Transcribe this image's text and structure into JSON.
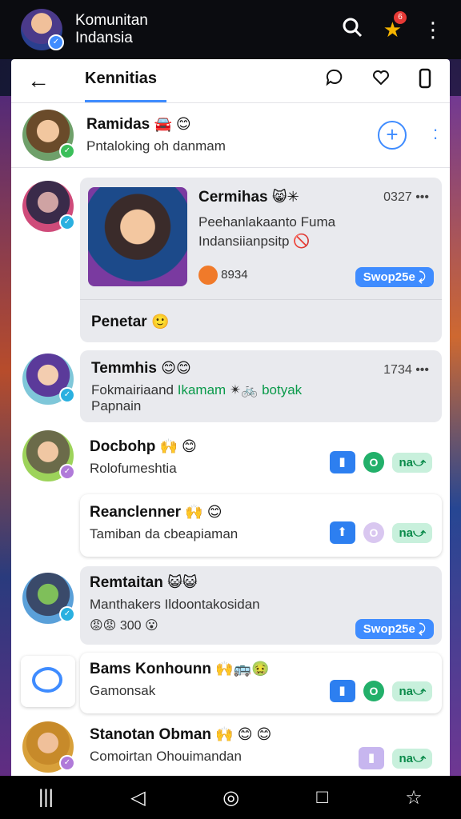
{
  "app": {
    "title_line1": "Komunitan",
    "title_line2": "Indansia",
    "notif_count": "6"
  },
  "tabbar": {
    "tab_label": "Kennitias"
  },
  "header": {
    "name": "Ramidas",
    "subtitle": "Pntaloking oh danmam"
  },
  "post": {
    "title": "Cermihas",
    "time": "0327",
    "line1": "Peehanlakaanto Fuma",
    "line2": "Indansiianpsitp",
    "stat": "8934",
    "pill": "Swop25e",
    "footer": "Penetar"
  },
  "items": [
    {
      "name": "Temmhis",
      "time": "1734",
      "line1": "Fokmairiaand",
      "line1_green": "Ikamam",
      "line1_tail": "botyak",
      "line2": "Papnain"
    },
    {
      "name": "Docbohp",
      "sub": "Rolofumeshtia",
      "btn_pill": "na"
    },
    {
      "name": "Reanclenner",
      "sub": "Tamiban da cbeapiaman",
      "btn_pill": "na"
    },
    {
      "name": "Remtaitan",
      "sub": "Manthakers Ildoontakosidan",
      "count": "300",
      "pill": "Swop25e"
    },
    {
      "name": "Bams Konhounn",
      "sub": "Gamonsak",
      "btn_pill": "na"
    },
    {
      "name": "Stanotan Obman",
      "sub": "Comoirtan Ohouimandan",
      "btn_pill": "na"
    }
  ]
}
